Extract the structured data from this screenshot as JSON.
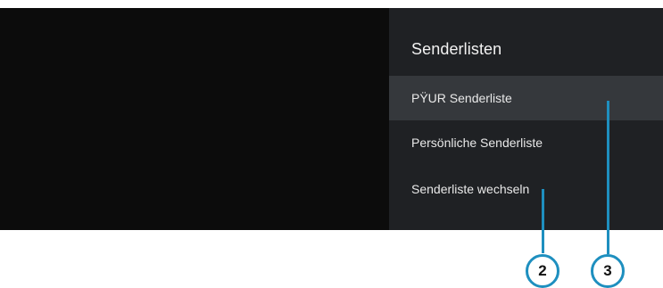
{
  "panel": {
    "title": "Senderlisten",
    "items": [
      {
        "label": "PŸUR Senderliste",
        "selected": true
      },
      {
        "label": "Persönliche Senderliste",
        "selected": false
      },
      {
        "label": "Senderliste wechseln",
        "selected": false
      }
    ]
  },
  "callouts": {
    "first": "2",
    "second": "3",
    "color": "#1e8fbf"
  },
  "colors": {
    "panel_bg": "#1f2124",
    "selected_bg": "#35383c",
    "video_bg": "#0c0c0c"
  }
}
